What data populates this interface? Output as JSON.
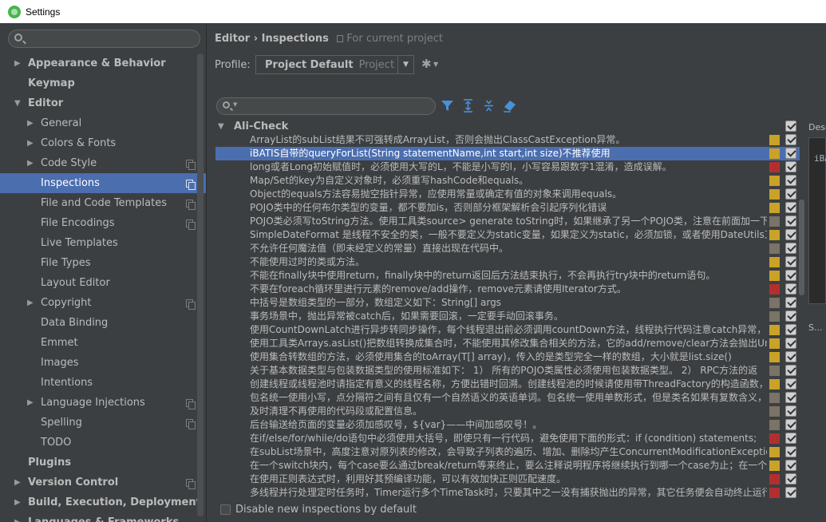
{
  "window": {
    "title": "Settings"
  },
  "sidebar": {
    "search_placeholder": "",
    "items": [
      {
        "label": "Appearance & Behavior",
        "level": 0,
        "arrow": "▶",
        "bold": true,
        "copy": false
      },
      {
        "label": "Keymap",
        "level": 0,
        "arrow": "",
        "bold": true,
        "copy": false
      },
      {
        "label": "Editor",
        "level": 0,
        "arrow": "▼",
        "bold": true,
        "copy": false
      },
      {
        "label": "General",
        "level": 1,
        "arrow": "▶",
        "bold": false,
        "copy": false
      },
      {
        "label": "Colors & Fonts",
        "level": 1,
        "arrow": "▶",
        "bold": false,
        "copy": false
      },
      {
        "label": "Code Style",
        "level": 1,
        "arrow": "▶",
        "bold": false,
        "copy": true
      },
      {
        "label": "Inspections",
        "level": 1,
        "arrow": "",
        "bold": false,
        "copy": true,
        "selected": true
      },
      {
        "label": "File and Code Templates",
        "level": 1,
        "arrow": "",
        "bold": false,
        "copy": true
      },
      {
        "label": "File Encodings",
        "level": 1,
        "arrow": "",
        "bold": false,
        "copy": true
      },
      {
        "label": "Live Templates",
        "level": 1,
        "arrow": "",
        "bold": false,
        "copy": false
      },
      {
        "label": "File Types",
        "level": 1,
        "arrow": "",
        "bold": false,
        "copy": false
      },
      {
        "label": "Layout Editor",
        "level": 1,
        "arrow": "",
        "bold": false,
        "copy": false
      },
      {
        "label": "Copyright",
        "level": 1,
        "arrow": "▶",
        "bold": false,
        "copy": true
      },
      {
        "label": "Data Binding",
        "level": 1,
        "arrow": "",
        "bold": false,
        "copy": false
      },
      {
        "label": "Emmet",
        "level": 1,
        "arrow": "",
        "bold": false,
        "copy": false
      },
      {
        "label": "Images",
        "level": 1,
        "arrow": "",
        "bold": false,
        "copy": false
      },
      {
        "label": "Intentions",
        "level": 1,
        "arrow": "",
        "bold": false,
        "copy": false
      },
      {
        "label": "Language Injections",
        "level": 1,
        "arrow": "▶",
        "bold": false,
        "copy": true
      },
      {
        "label": "Spelling",
        "level": 1,
        "arrow": "",
        "bold": false,
        "copy": true
      },
      {
        "label": "TODO",
        "level": 1,
        "arrow": "",
        "bold": false,
        "copy": false
      },
      {
        "label": "Plugins",
        "level": 0,
        "arrow": "",
        "bold": true,
        "copy": false
      },
      {
        "label": "Version Control",
        "level": 0,
        "arrow": "▶",
        "bold": true,
        "copy": true
      },
      {
        "label": "Build, Execution, Deployment",
        "level": 0,
        "arrow": "▶",
        "bold": true,
        "copy": false
      },
      {
        "label": "Languages & Frameworks",
        "level": 0,
        "arrow": "▶",
        "bold": true,
        "copy": false
      }
    ]
  },
  "header": {
    "breadcrumb_parent": "Editor",
    "breadcrumb_sep": "›",
    "breadcrumb_current": "Inspections",
    "scope": "For current project"
  },
  "profile": {
    "label": "Profile:",
    "name": "Project Default",
    "kind": "Project"
  },
  "filter": {
    "placeholder": ""
  },
  "inspections": {
    "group": "Ali-Check",
    "rows": [
      {
        "text": "ArrayList的subList结果不可强转成ArrayList，否则会抛出ClassCastException异常。",
        "severity": "#c9a227"
      },
      {
        "text": "iBATIS自带的queryForList(String statementName,int start,int size)不推荐使用",
        "severity": "#c9a227",
        "selected": true
      },
      {
        "text": "long或者Long初始赋值时，必须使用大写的L，不能是小写的l，小写容易跟数字1混淆，造成误解。",
        "severity": "#b32f2f"
      },
      {
        "text": "Map/Set的key为自定义对象时，必须重写hashCode和equals。",
        "severity": "#c9a227"
      },
      {
        "text": "Object的equals方法容易抛空指针异常，应使用常量或确定有值的对象来调用equals。",
        "severity": "#c9a227"
      },
      {
        "text": "POJO类中的任何布尔类型的变量，都不要加is，否则部分框架解析会引起序列化错误",
        "severity": "#c9a227"
      },
      {
        "text": "POJO类必须写toString方法。使用工具类source> generate toString时，如果继承了另一个POJO类，注意在前面加一下",
        "severity": "#7a7366"
      },
      {
        "text": "SimpleDateFormat 是线程不安全的类，一般不要定义为static变量，如果定义为static，必须加锁，或者使用DateUtils工具",
        "severity": "#c9a227"
      },
      {
        "text": "不允许任何魔法值（即未经定义的常量）直接出现在代码中。",
        "severity": "#7a7366"
      },
      {
        "text": "不能使用过时的类或方法。",
        "severity": "#c9a227"
      },
      {
        "text": "不能在finally块中使用return，finally块中的return返回后方法结束执行，不会再执行try块中的return语句。",
        "severity": "#c9a227"
      },
      {
        "text": "不要在foreach循环里进行元素的remove/add操作，remove元素请使用Iterator方式。",
        "severity": "#b32f2f"
      },
      {
        "text": "中括号是数组类型的一部分，数组定义如下：String[] args",
        "severity": "#7a7366"
      },
      {
        "text": "事务场景中，抛出异常被catch后，如果需要回滚，一定要手动回滚事务。",
        "severity": "#7a7366"
      },
      {
        "text": "使用CountDownLatch进行异步转同步操作，每个线程退出前必须调用countDown方法，线程执行代码注意catch异常，确",
        "severity": "#c9a227"
      },
      {
        "text": "使用工具类Arrays.asList()把数组转换成集合时，不能使用其修改集合相关的方法，它的add/remove/clear方法会抛出Uns",
        "severity": "#c9a227"
      },
      {
        "text": "使用集合转数组的方法，必须使用集合的toArray(T[] array)，传入的是类型完全一样的数组，大小就是list.size()",
        "severity": "#c9a227"
      },
      {
        "text": "关于基本数据类型与包装数据类型的使用标准如下：  1） 所有的POJO类属性必须使用包装数据类型。    2） RPC方法的返",
        "severity": "#7a7366"
      },
      {
        "text": "创建线程或线程池时请指定有意义的线程名称，方便出错时回溯。创建线程池的时候请使用带ThreadFactory的构造函数，",
        "severity": "#c9a227"
      },
      {
        "text": "包名统一使用小写，点分隔符之间有且仅有一个自然语义的英语单词。包名统一使用单数形式，但是类名如果有复数含义，",
        "severity": "#7a7366"
      },
      {
        "text": "及时清理不再使用的代码段或配置信息。",
        "severity": "#7a7366"
      },
      {
        "text": "后台输送给页面的变量必须加感叹号，${var}——中间加感叹号！。",
        "severity": "#7a7366"
      },
      {
        "text": "在if/else/for/while/do语句中必须使用大括号，即使只有一行代码，避免使用下面的形式：if (condition) statements;",
        "severity": "#b32f2f"
      },
      {
        "text": "在subList场景中，高度注意对原列表的修改，会导致子列表的遍历、增加、删除均产生ConcurrentModificationExceptio",
        "severity": "#c9a227"
      },
      {
        "text": "在一个switch块内，每个case要么通过break/return等来终止，要么注释说明程序将继续执行到哪一个case为止；在一个s",
        "severity": "#c9a227"
      },
      {
        "text": "在使用正则表达式时，利用好其预编译功能，可以有效加快正则匹配速度。",
        "severity": "#b32f2f"
      },
      {
        "text": "多线程并行处理定时任务时，Timer运行多个TimeTask时，只要其中之一没有捕获抛出的异常，其它任务便会自动终止运行",
        "severity": "#b32f2f"
      }
    ]
  },
  "disable_new": {
    "label": "Disable new inspections by default"
  },
  "description": {
    "label": "Desc",
    "code_snippet": "iBA",
    "second_label": "S..."
  },
  "colors": {
    "selection": "#4b6eaf",
    "background": "#3c3f41"
  }
}
